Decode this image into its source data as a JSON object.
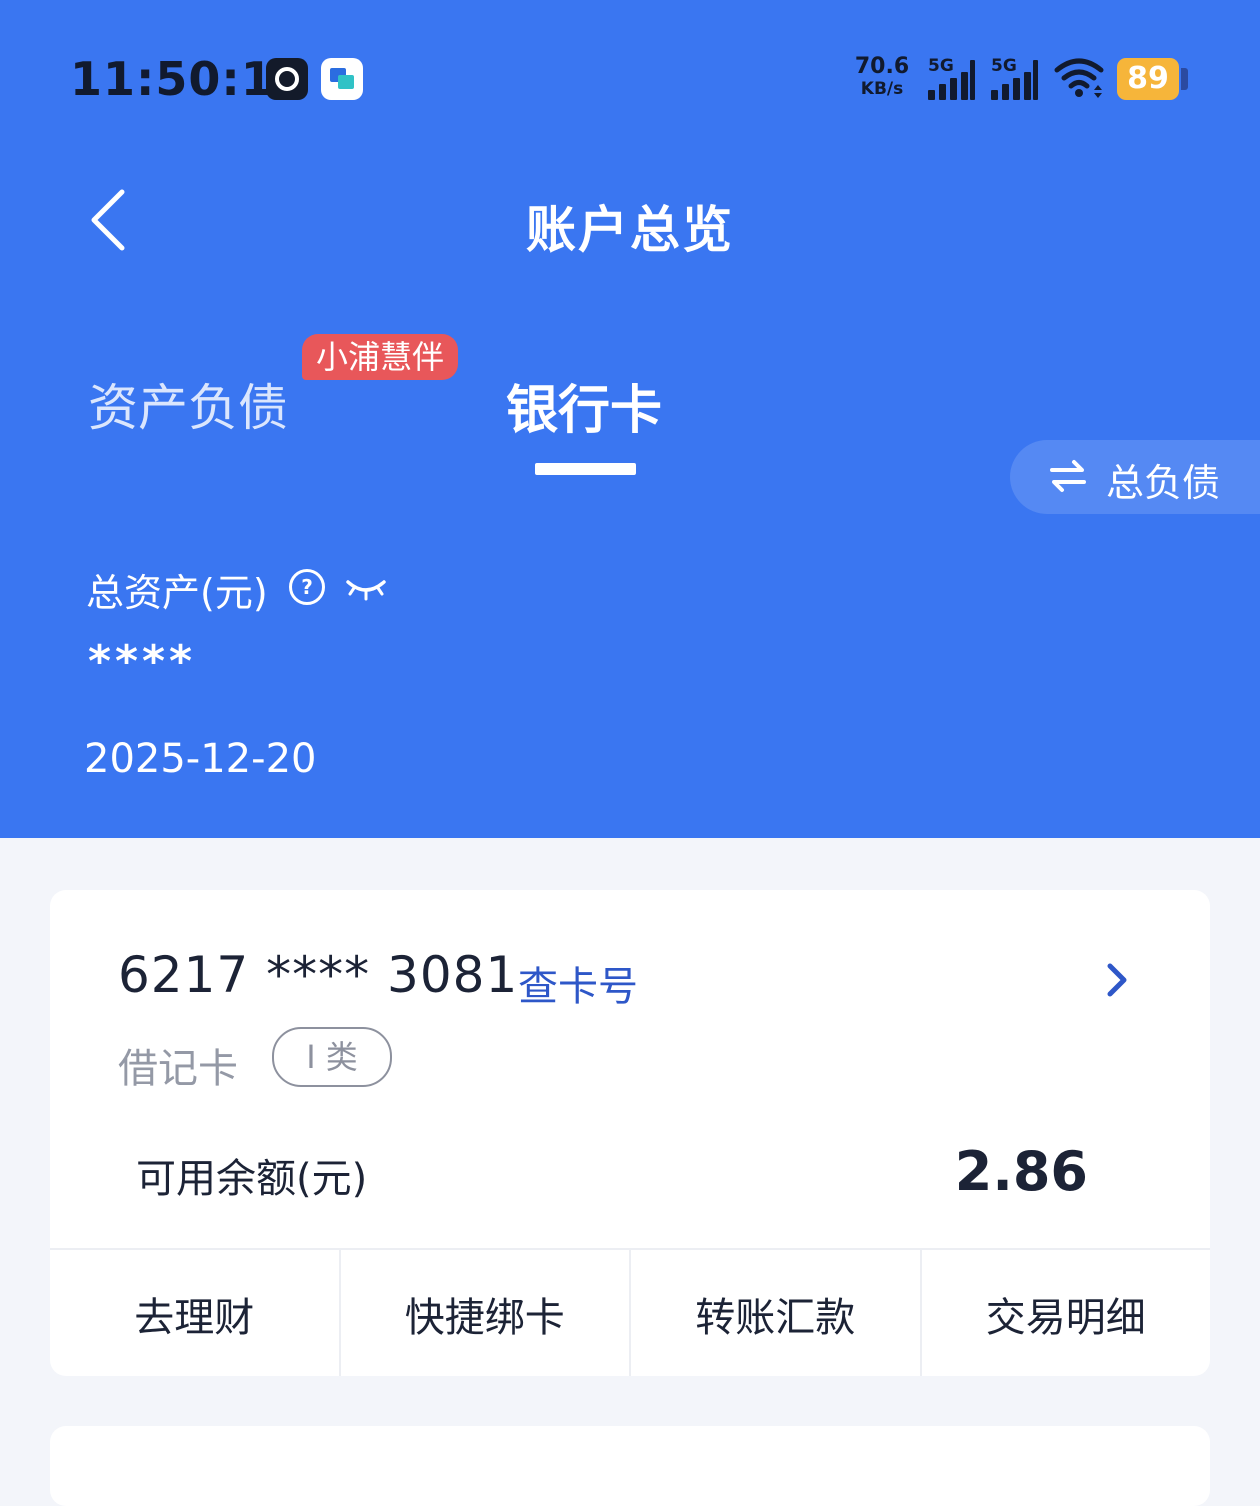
{
  "status_bar": {
    "time": "11:50:12",
    "net_speed_value": "70.6",
    "net_speed_unit": "KB/s",
    "signal1_label": "5G",
    "signal2_label": "5G",
    "battery": "89"
  },
  "nav": {
    "title": "账户总览"
  },
  "tabs": {
    "assets_label": "资产负债",
    "promo_badge": "小浦慧伴",
    "cards_label": "银行卡",
    "liabilities_button": "总负债"
  },
  "summary": {
    "total_assets_label": "总资产(元)",
    "total_assets_value": "****",
    "date": "2025-12-20"
  },
  "card": {
    "number": "6217 **** 3081",
    "lookup_label": "查卡号",
    "type": "借记卡",
    "class_badge": "I 类",
    "balance_label": "可用余额(元)",
    "balance_value": "2.86",
    "actions": [
      "去理财",
      "快捷绑卡",
      "转账汇款",
      "交易明细"
    ]
  },
  "colors": {
    "header_bg": "#3a76f1",
    "badge_red": "#e8575a",
    "link_blue": "#2e57c8",
    "battery": "#f6b53a"
  }
}
